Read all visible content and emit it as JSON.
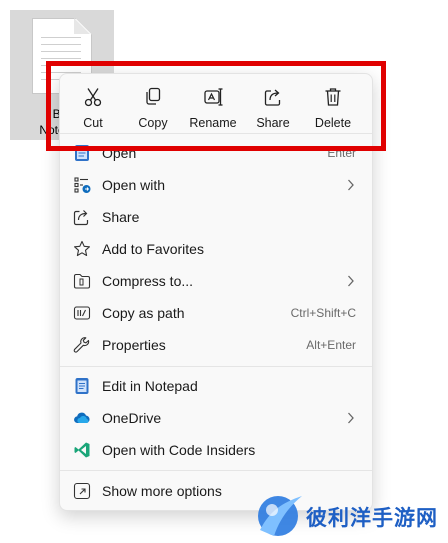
{
  "desktop_file": {
    "label_line1": "Bra",
    "label_line2": "Notepad"
  },
  "quick_actions": [
    {
      "label": "Cut",
      "icon": "scissors-icon"
    },
    {
      "label": "Copy",
      "icon": "copy-icon"
    },
    {
      "label": "Rename",
      "icon": "rename-icon"
    },
    {
      "label": "Share",
      "icon": "share-icon"
    },
    {
      "label": "Delete",
      "icon": "trash-icon"
    }
  ],
  "menu": {
    "open": {
      "label": "Open",
      "shortcut": "Enter",
      "icon": "notepad-icon"
    },
    "open_with": {
      "label": "Open with",
      "icon": "open-with-icon"
    },
    "share": {
      "label": "Share",
      "icon": "share-icon"
    },
    "add_favorites": {
      "label": "Add to Favorites",
      "icon": "star-icon"
    },
    "compress": {
      "label": "Compress to...",
      "icon": "zip-folder-icon"
    },
    "copy_path": {
      "label": "Copy as path",
      "shortcut": "Ctrl+Shift+C",
      "icon": "copy-path-icon"
    },
    "properties": {
      "label": "Properties",
      "shortcut": "Alt+Enter",
      "icon": "wrench-icon"
    },
    "edit_notepad": {
      "label": "Edit in Notepad",
      "icon": "notepad-icon"
    },
    "onedrive": {
      "label": "OneDrive",
      "icon": "cloud-icon"
    },
    "code_insiders": {
      "label": "Open with Code Insiders",
      "icon": "vscode-insiders-icon"
    },
    "show_more": {
      "label": "Show more options",
      "icon": "expand-icon"
    }
  },
  "colors": {
    "highlight_box": "#e00000",
    "menu_bg": "#f9f9f9",
    "accent_blue": "#0f6cbd"
  },
  "watermark": {
    "text": "彼利洋手游网"
  }
}
